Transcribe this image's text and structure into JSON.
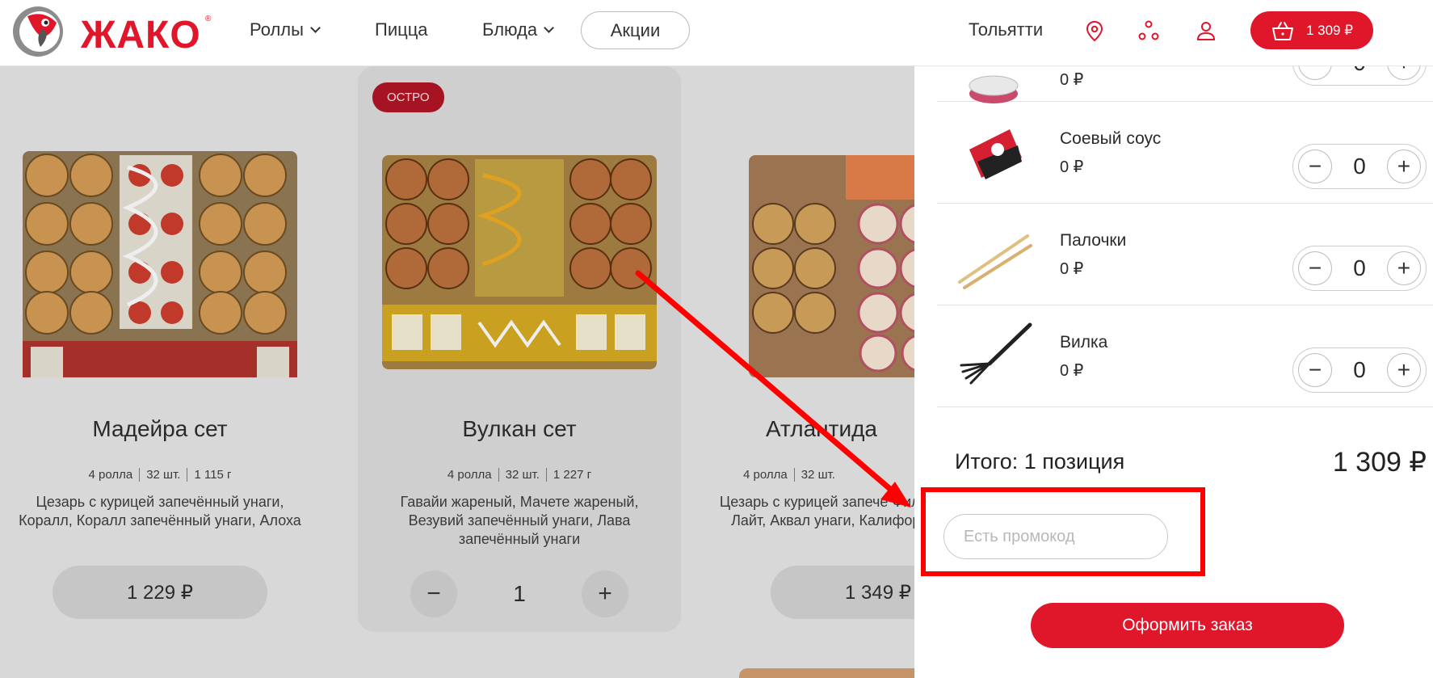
{
  "header": {
    "logo_text": "ЖАКО",
    "logo_reg": "®",
    "nav": [
      {
        "label": "Роллы",
        "has_dropdown": true
      },
      {
        "label": "Пицца",
        "has_dropdown": false
      },
      {
        "label": "Блюда",
        "has_dropdown": true
      }
    ],
    "promo_label": "Акции",
    "city": "Тольятти",
    "icons": [
      "location-pin-icon",
      "network-icon",
      "user-icon"
    ],
    "cart_total": "1 309 ₽"
  },
  "catalog": [
    {
      "title": "Мадейра сет",
      "meta": [
        "4 ролла",
        "32 шт.",
        "1 115 г"
      ],
      "description": "Цезарь с курицей запечённый унаги, Коралл, Коралл запечённый унаги, Алоха",
      "price": "1 229 ₽",
      "badge": null,
      "quantity": null
    },
    {
      "title": "Вулкан сет",
      "meta": [
        "4 ролла",
        "32 шт.",
        "1 227 г"
      ],
      "description": "Гавайи жареный, Мачете жареный, Везувий запечённый унаги, Лава запечённый унаги",
      "price": null,
      "badge": "ОСТРО",
      "quantity": "1"
    },
    {
      "title": "Атлантида",
      "meta": [
        "4 ролла",
        "32 шт.",
        ""
      ],
      "description": "Цезарь с курицей запече Филадельфия Лайт, Аквал унаги, Калифорния с ло",
      "price": "1 349 ₽",
      "badge": null,
      "quantity": null
    }
  ],
  "cart": {
    "items": [
      {
        "name": "",
        "price": "0 ₽",
        "qty": "0",
        "icon": "sauce-cup-icon"
      },
      {
        "name": "Соевый соус",
        "price": "0 ₽",
        "qty": "0",
        "icon": "soy-sauce-icon"
      },
      {
        "name": "Палочки",
        "price": "0 ₽",
        "qty": "0",
        "icon": "chopsticks-icon"
      },
      {
        "name": "Вилка",
        "price": "0 ₽",
        "qty": "0",
        "icon": "fork-icon"
      }
    ],
    "total_label": "Итого: 1 позиция",
    "total_price": "1 309 ₽",
    "promo_placeholder": "Есть промокод",
    "checkout_label": "Оформить заказ"
  },
  "colors": {
    "brand": "#e0162b",
    "annotation": "#ff0000"
  }
}
